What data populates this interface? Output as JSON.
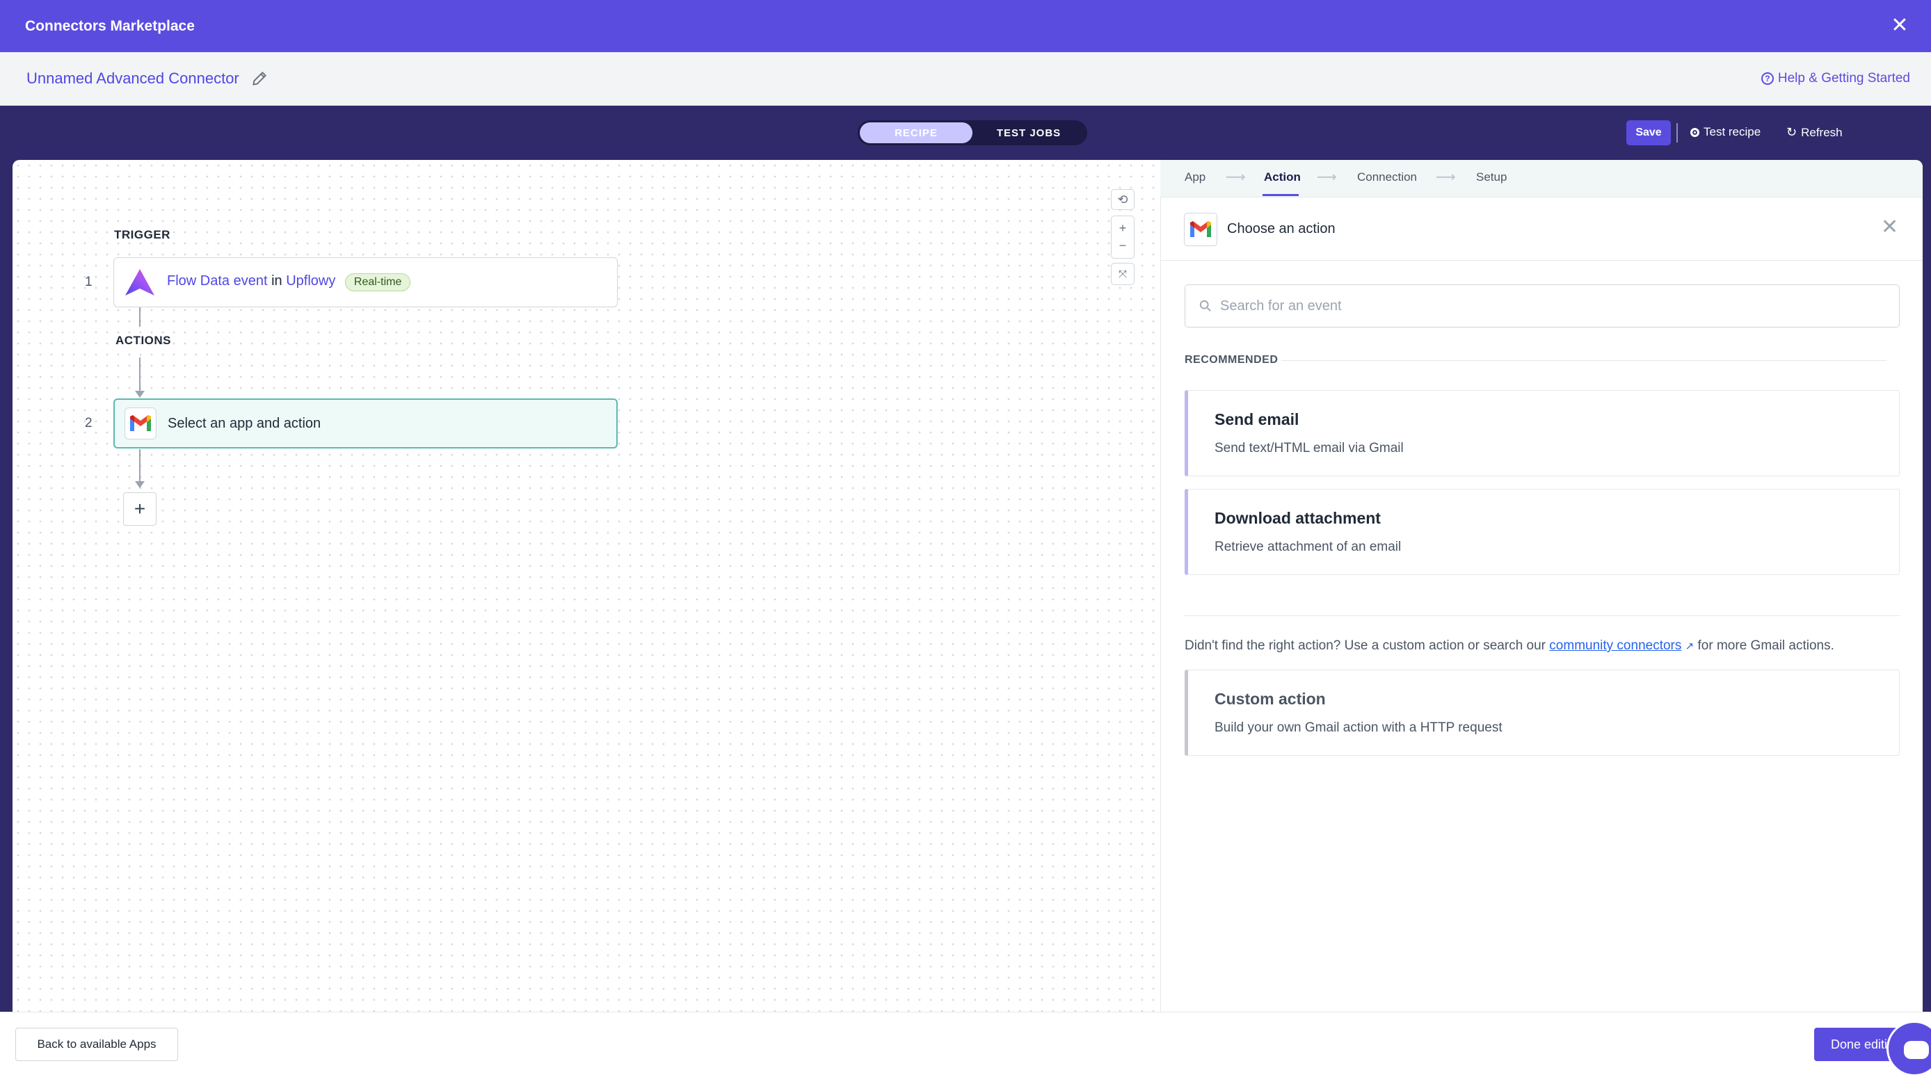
{
  "window": {
    "title": "Connectors Marketplace"
  },
  "subheader": {
    "connector_name": "Unnamed Advanced Connector",
    "help_link": "Help & Getting Started"
  },
  "toolbar": {
    "tabs": [
      {
        "label": "RECIPE",
        "active": true
      },
      {
        "label": "TEST JOBS",
        "active": false
      }
    ],
    "save_label": "Save",
    "test_recipe_label": "Test recipe",
    "refresh_label": "Refresh"
  },
  "recipe": {
    "trigger_label": "TRIGGER",
    "actions_label": "ACTIONS",
    "steps": [
      {
        "number": "1",
        "event": "Flow Data event",
        "connector_word": "in",
        "app": "Upflowy",
        "badge": "Real-time",
        "icon": "upflowy-logo-icon"
      },
      {
        "number": "2",
        "text": "Select an app and action",
        "icon": "gmail-logo-icon"
      }
    ],
    "add_step_symbol": "+"
  },
  "panel": {
    "steps_nav": [
      {
        "label": "App",
        "active": false
      },
      {
        "label": "Action",
        "active": true
      },
      {
        "label": "Connection",
        "active": false
      },
      {
        "label": "Setup",
        "active": false
      }
    ],
    "title": "Choose an action",
    "search_placeholder": "Search for an event",
    "recommended_label": "RECOMMENDED",
    "actions": [
      {
        "title": "Send email",
        "description": "Send text/HTML email via Gmail"
      },
      {
        "title": "Download attachment",
        "description": "Retrieve attachment of an email"
      }
    ],
    "hint_prefix": "Didn't find the right action? Use a custom action or search our",
    "hint_link": "community connectors",
    "hint_suffix": "for more Gmail actions.",
    "custom_action": {
      "title": "Custom action",
      "description": "Build your own Gmail action with a HTTP request"
    }
  },
  "footer": {
    "back_label": "Back to available Apps",
    "done_label": "Done editing"
  },
  "colors": {
    "brand": "#5b4ce0",
    "band": "#302a6b",
    "link": "#4f46e5",
    "active_step_border": "#5cb8b2"
  }
}
